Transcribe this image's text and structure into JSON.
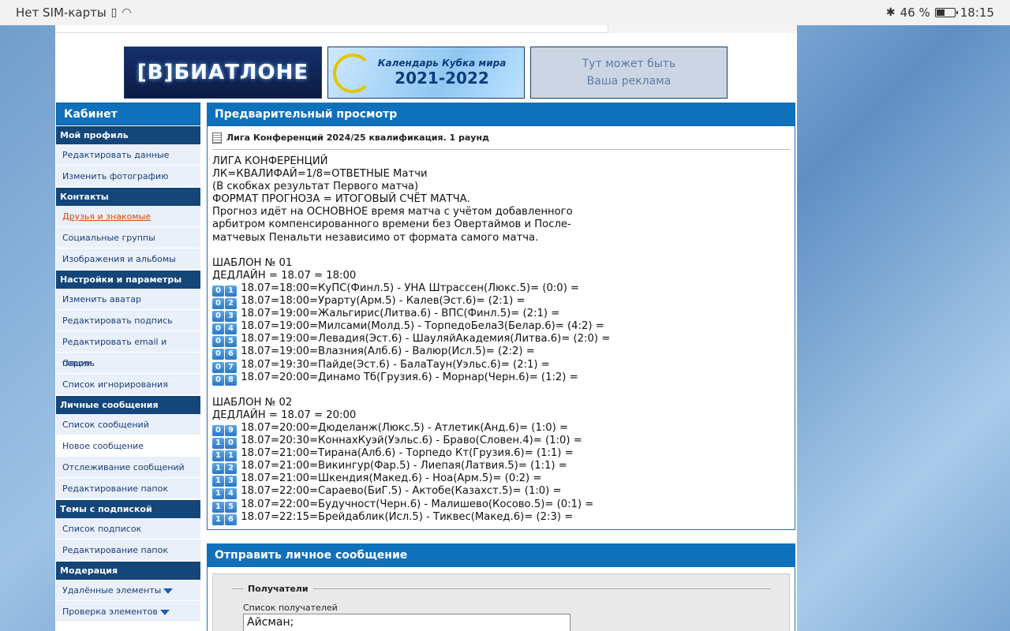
{
  "statusbar": {
    "carrier": "Нет SIM-карты",
    "battery_text": "46 %",
    "battery_level": 0.46,
    "time": "18:15"
  },
  "banners": {
    "b1": "[В]БИАТЛОНЕ",
    "b2_line1": "Календарь Кубка мира",
    "b2_line2": "2021-2022",
    "b3_line1": "Тут может быть",
    "b3_line2": "Ваша реклама"
  },
  "sidebar": {
    "title": "Кабинет",
    "sections": [
      {
        "title": "Мой профиль",
        "items": [
          "Редактировать данные",
          "Изменить фотографию"
        ]
      },
      {
        "title": "Контакты",
        "items": [
          "Друзья и знакомые",
          "Социальные группы",
          "Изображения и альбомы"
        ]
      },
      {
        "title": "Настройки и параметры",
        "items": [
          "Изменить аватар",
          "Редактировать подпись",
          "Редактировать email и пароль",
          "Опции",
          "Список игнорирования"
        ]
      },
      {
        "title": "Личные сообщения",
        "items": [
          "Список сообщений",
          "Новое сообщение",
          "Отслеживание сообщений",
          "Редактирование папок"
        ]
      },
      {
        "title": "Темы с подпиской",
        "items": [
          "Список подписок",
          "Редактирование папок"
        ]
      },
      {
        "title": "Модерация",
        "items": [
          "Удалённые элементы",
          "Проверка элементов"
        ]
      }
    ]
  },
  "preview": {
    "title": "Предварительный просмотр",
    "doc_title": "Лига Конференций 2024/25 квалификация. 1 раунд",
    "lines": [
      {
        "k": "",
        "t": "ЛИГА КОНФЕРЕНЦИЙ"
      },
      {
        "k": "",
        "t": "ЛК=КВАЛИФАЙ=1/8=ОТВЕТНЫЕ Матчи"
      },
      {
        "k": "",
        "t": "(В скобках результат Первого матча)"
      },
      {
        "k": "",
        "t": "ФОРМАТ ПРОГНОЗА = ИТОГОВЫЙ СЧЁТ МАТЧА."
      },
      {
        "k": "",
        "t": "Прогноз идёт на ОСНОВНОЕ время матча с учётом добавленного"
      },
      {
        "k": "",
        "t": "арбитром компенсированного времени без Овертаймов и После-"
      },
      {
        "k": "",
        "t": "матчевых Пенальти независимо от формата самого матча."
      },
      {
        "k": "",
        "t": ""
      },
      {
        "k": "",
        "t": "ШАБЛОН № 01"
      },
      {
        "k": "",
        "t": "ДЕДЛАЙН = 18.07 = 18:00"
      },
      {
        "k": "01",
        "t": "18.07=18:00=КуПС(Финл.5) - УНА Штрассен(Люкс.5)= (0:0) ="
      },
      {
        "k": "02",
        "t": "18.07=18:00=Урарту(Арм.5) - Калев(Эст.6)= (2:1) ="
      },
      {
        "k": "03",
        "t": "18.07=19:00=Жальгирис(Литва.6) - ВПС(Финл.5)= (2:1) ="
      },
      {
        "k": "04",
        "t": "18.07=19:00=Милсами(Молд.5) - ТорпедоБелаЗ(Белар.6)= (4:2) ="
      },
      {
        "k": "05",
        "t": "18.07=19:00=Левадия(Эст.6) - ШауляйАкадемия(Литва.6)= (2:0) ="
      },
      {
        "k": "06",
        "t": "18.07=19:00=Влазния(Алб.6) - Валюр(Исл.5)= (2:2) ="
      },
      {
        "k": "07",
        "t": "18.07=19:30=Пайде(Эст.6) - БалаТаун(Уэльс.6)= (2:1) ="
      },
      {
        "k": "08",
        "t": "18.07=20:00=Динамо Тб(Грузия.6) - Морнар(Черн.6)= (1:2) ="
      },
      {
        "k": "",
        "t": ""
      },
      {
        "k": "",
        "t": "ШАБЛОН № 02"
      },
      {
        "k": "",
        "t": "ДЕДЛАЙН = 18.07 = 20:00"
      },
      {
        "k": "09",
        "t": "18.07=20:00=Дюделанж(Люкс.5) - Атлетик(Анд.6)= (1:0) ="
      },
      {
        "k": "10",
        "t": "18.07=20:30=КоннахКуэй(Уэльс.6) - Браво(Словен.4)= (1:0) ="
      },
      {
        "k": "11",
        "t": "18.07=21:00=Тирана(Алб.6) - Торпедо Кт(Грузия.6)= (1:1) ="
      },
      {
        "k": "12",
        "t": "18.07=21:00=Викингур(Фар.5) - Лиепая(Латвия.5)= (1:1) ="
      },
      {
        "k": "13",
        "t": "18.07=21:00=Шкендия(Макед.6) - Ноа(Арм.5)= (0:2) ="
      },
      {
        "k": "14",
        "t": "18.07=22:00=Сараево(БиГ.5) - Актобе(Казахст.5)= (1:0) ="
      },
      {
        "k": "15",
        "t": "18.07=22:00=Будучност(Черн.6) - Малишево(Косово.5)= (0:1) ="
      },
      {
        "k": "16",
        "t": "18.07=22:15=Брейдаблик(Исл.5) - Тиквес(Макед.6)= (2:3) ="
      }
    ]
  },
  "send": {
    "title": "Отправить личное сообщение",
    "legend": "Получатели",
    "recipients_label": "Список получателей",
    "recipients_value": "Айсман;"
  }
}
